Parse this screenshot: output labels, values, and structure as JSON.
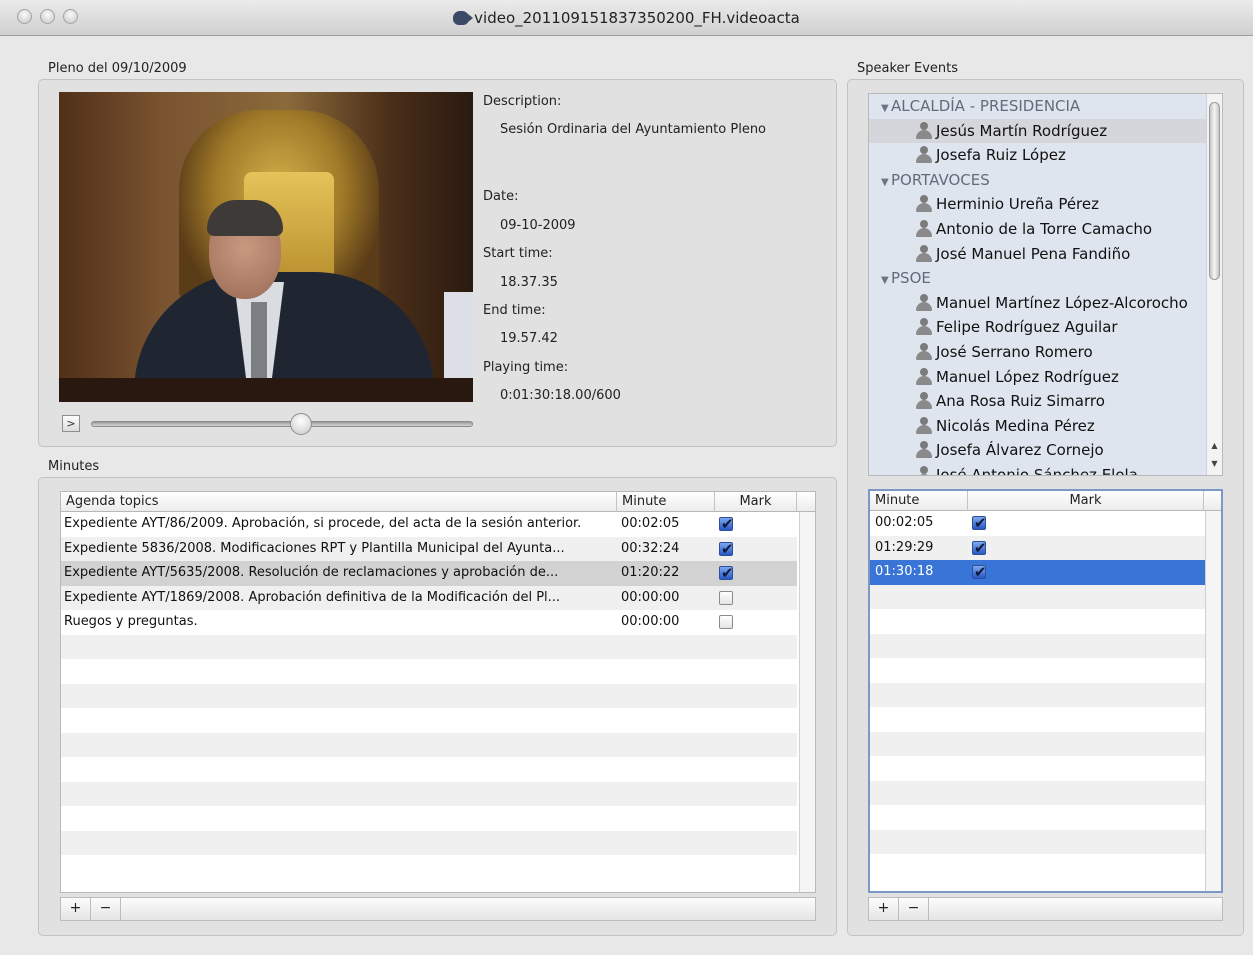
{
  "window": {
    "title": "video_201109151837350200_FH.videoacta"
  },
  "session": {
    "group_label": "Pleno del 09/10/2009",
    "description_label": "Description:",
    "description_value": "Sesión Ordinaria del Ayuntamiento Pleno",
    "date_label": "Date:",
    "date_value": "09-10-2009",
    "start_label": "Start time:",
    "start_value": "18.37.35",
    "end_label": "End time:",
    "end_value": "19.57.42",
    "playing_label": "Playing time:",
    "playing_value": "0:01:30:18.00/600",
    "play_button_label": ">",
    "playback_position": 0.55
  },
  "speakers": {
    "group_label": "Speaker Events",
    "tree": [
      {
        "type": "group",
        "label": "ALCALDÍA - PRESIDENCIA"
      },
      {
        "type": "person",
        "label": "Jesús Martín Rodríguez",
        "selected": true
      },
      {
        "type": "person",
        "label": "Josefa Ruiz López"
      },
      {
        "type": "group",
        "label": "PORTAVOCES"
      },
      {
        "type": "person",
        "label": "Herminio Ureña Pérez"
      },
      {
        "type": "person",
        "label": "Antonio de la Torre Camacho"
      },
      {
        "type": "person",
        "label": "José Manuel Pena Fandiño"
      },
      {
        "type": "group",
        "label": "PSOE"
      },
      {
        "type": "person",
        "label": "Manuel Martínez López-Alcorocho"
      },
      {
        "type": "person",
        "label": "Felipe Rodríguez Aguilar"
      },
      {
        "type": "person",
        "label": "José Serrano Romero"
      },
      {
        "type": "person",
        "label": "Manuel López Rodríguez"
      },
      {
        "type": "person",
        "label": "Ana Rosa Ruiz Simarro"
      },
      {
        "type": "person",
        "label": "Nicolás Medina Pérez"
      },
      {
        "type": "person",
        "label": "Josefa Álvarez Cornejo"
      },
      {
        "type": "person",
        "label": "José Antonio Sánchez Elola"
      }
    ],
    "events_columns": {
      "minute": "Minute",
      "mark": "Mark"
    },
    "events": [
      {
        "minute": "00:02:05",
        "mark": true
      },
      {
        "minute": "01:29:29",
        "mark": true
      },
      {
        "minute": "01:30:18",
        "mark": true,
        "selected": true
      }
    ],
    "add_label": "+",
    "remove_label": "−"
  },
  "minutes": {
    "group_label": "Minutes",
    "columns": {
      "topic": "Agenda topics",
      "minute": "Minute",
      "mark": "Mark"
    },
    "rows": [
      {
        "topic": "Expediente AYT/86/2009. Aprobación, si procede, del acta de la sesión anterior.",
        "minute": "00:02:05",
        "mark": true
      },
      {
        "topic": "Expediente 5836/2008.  Modificaciones RPT y Plantilla Municipal del Ayunta...",
        "minute": "00:32:24",
        "mark": true
      },
      {
        "topic": "Expediente AYT/5635/2008.  Resolución de reclamaciones y aprobación de...",
        "minute": "01:20:22",
        "mark": true,
        "selected": true
      },
      {
        "topic": "Expediente AYT/1869/2008.  Aprobación definitiva de la Modificación del Pl...",
        "minute": "00:00:00",
        "mark": false
      },
      {
        "topic": "Ruegos y preguntas.",
        "minute": "00:00:00",
        "mark": false
      }
    ],
    "add_label": "+",
    "remove_label": "−"
  }
}
